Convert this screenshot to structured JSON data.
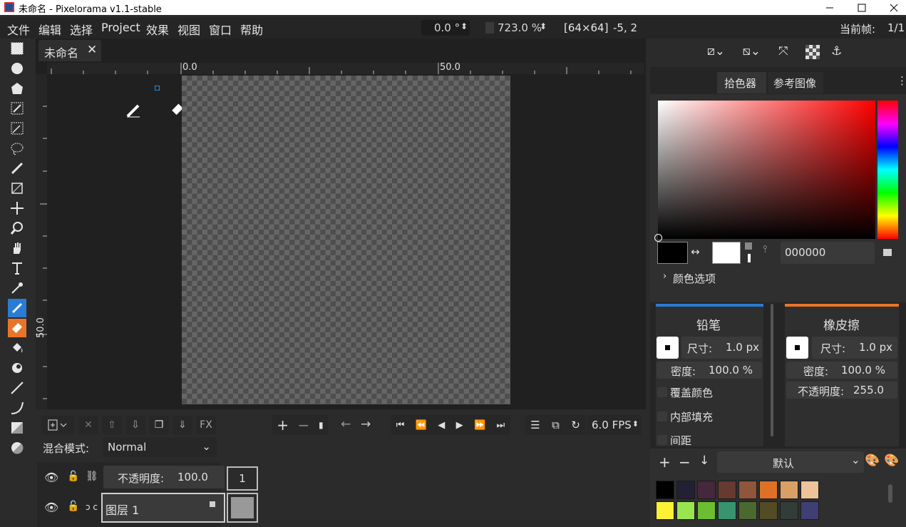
{
  "window": {
    "title": "未命名 - Pixelorama v1.1-stable"
  },
  "menu": {
    "items": [
      "文件",
      "编辑",
      "选择",
      "Project",
      "效果",
      "视图",
      "窗口",
      "帮助"
    ],
    "rotation": "0.0 °",
    "zoom": "723.0 %",
    "size": "[64×64]",
    "coords": "-5, 2",
    "current_frame_label": "当前帧:",
    "current_frame_value": "1/1"
  },
  "canvas": {
    "tab_label": "未命名",
    "ruler_h_labels": [
      "0.0",
      "50.0"
    ],
    "ruler_v_label": "50.0"
  },
  "layers": {
    "blend_mode_label": "混合模式:",
    "blend_mode_value": "Normal",
    "opacity_label": "不透明度:",
    "opacity_value": "100.0",
    "frame_number": "1",
    "layer_name": "图层 1",
    "fx_label": "FX"
  },
  "animation": {
    "fps": "6.0 FPS"
  },
  "color_picker": {
    "tabs": [
      "拾色器",
      "参考图像"
    ],
    "hex_value": "000000",
    "color_options_label": "颜色选项",
    "primary_color": "#000000",
    "secondary_color": "#ffffff"
  },
  "tool_left": {
    "title": "铅笔",
    "accent": "#2a7bd3",
    "size_label": "尺寸:",
    "size_value": "1.0 px",
    "density_label": "密度:",
    "density_value": "100.0 %",
    "options": [
      "覆盖颜色",
      "内部填充",
      "间距"
    ]
  },
  "tool_right": {
    "title": "橡皮擦",
    "accent": "#e8752a",
    "size_label": "尺寸:",
    "size_value": "1.0 px",
    "density_label": "密度:",
    "density_value": "100.0 %",
    "opacity_label": "不透明度:",
    "opacity_value": "255.0"
  },
  "palette": {
    "name": "默认",
    "colors": [
      "#000000",
      "#222034",
      "#45283c",
      "#663931",
      "#8f563b",
      "#df7126",
      "#d9a066",
      "#eec39a",
      "#fbf236",
      "#99e550",
      "#6abe30",
      "#37946e",
      "#4b692f",
      "#524b24",
      "#323c39",
      "#3f3f74"
    ]
  }
}
